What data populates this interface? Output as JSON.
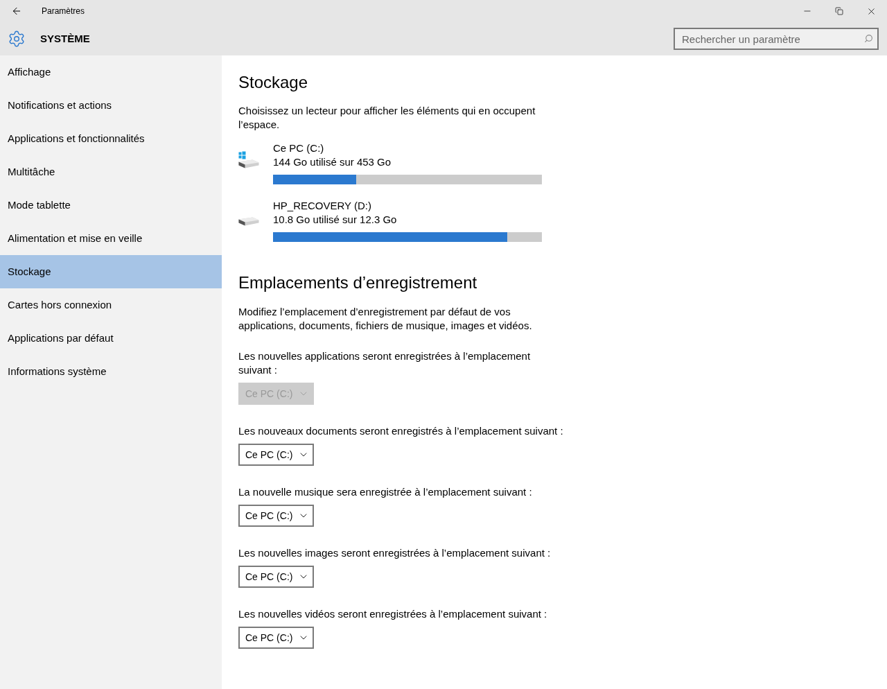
{
  "window": {
    "title": "Paramètres"
  },
  "header": {
    "title": "SYSTÈME",
    "search": {
      "placeholder": "Rechercher un paramètre"
    }
  },
  "sidebar": {
    "items": [
      {
        "label": "Affichage",
        "selected": false
      },
      {
        "label": "Notifications et actions",
        "selected": false
      },
      {
        "label": "Applications et fonctionnalités",
        "selected": false
      },
      {
        "label": "Multitâche",
        "selected": false
      },
      {
        "label": "Mode tablette",
        "selected": false
      },
      {
        "label": "Alimentation et mise en veille",
        "selected": false
      },
      {
        "label": "Stockage",
        "selected": true
      },
      {
        "label": "Cartes hors connexion",
        "selected": false
      },
      {
        "label": "Applications par défaut",
        "selected": false
      },
      {
        "label": "Informations système",
        "selected": false
      }
    ]
  },
  "storage": {
    "title": "Stockage",
    "description": "Choisissez un lecteur pour afficher les éléments qui en occupent l’espace.",
    "drives": [
      {
        "kind": "system",
        "name": "Ce PC (C:)",
        "usage": "144 Go utilisé sur 453 Go",
        "level": 0.31
      },
      {
        "kind": "plain",
        "name": "HP_RECOVERY (D:)",
        "usage": "10.8 Go utilisé sur 12.3 Go",
        "level": 0.87
      }
    ]
  },
  "save_locations": {
    "title": "Emplacements d’enregistrement",
    "description": "Modifiez l’emplacement d’enregistrement par défaut de vos applications, documents, fichiers de musique, images et vidéos.",
    "settings": [
      {
        "label": "Les nouvelles applications seront enregistrées à l’emplacement suivant :",
        "value": "Ce PC (C:)",
        "disabled": true
      },
      {
        "label": "Les nouveaux documents seront enregistrés à l’emplacement suivant :",
        "value": "Ce PC (C:)",
        "disabled": false
      },
      {
        "label": "La nouvelle musique sera enregistrée à l’emplacement suivant :",
        "value": "Ce PC (C:)",
        "disabled": false
      },
      {
        "label": "Les nouvelles images seront enregistrées à l’emplacement suivant :",
        "value": "Ce PC (C:)",
        "disabled": false
      },
      {
        "label": "Les nouvelles vidéos seront enregistrées à l’emplacement suivant :",
        "value": "Ce PC (C:)",
        "disabled": false
      }
    ]
  }
}
